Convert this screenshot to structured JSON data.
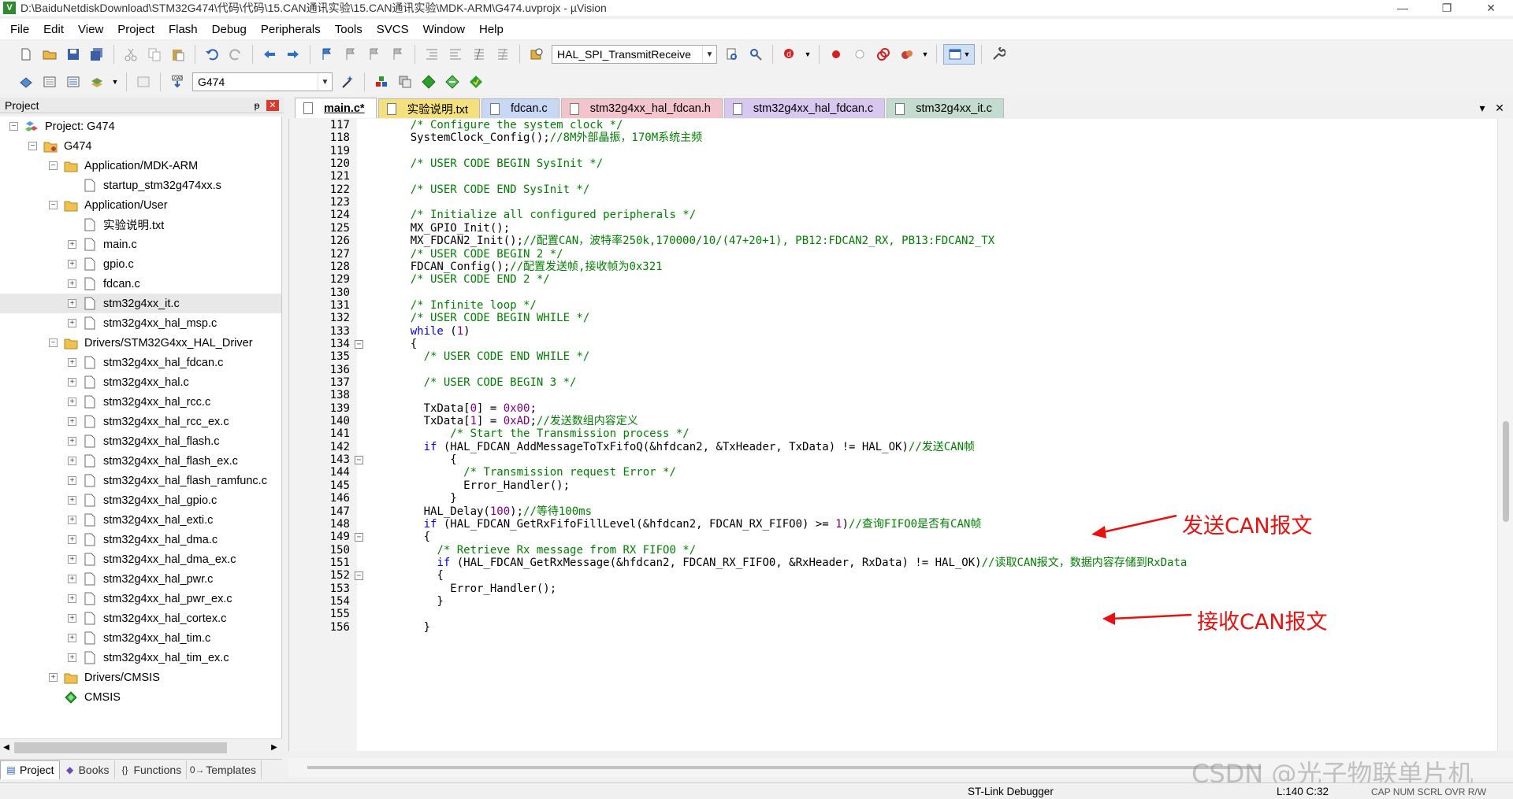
{
  "window": {
    "title": "D:\\BaiduNetdiskDownload\\STM32G474\\代码\\代码\\15.CAN通讯实验\\15.CAN通讯实验\\MDK-ARM\\G474.uvprojx - µVision",
    "minimize": "—",
    "maximize": "❐",
    "close": "✕"
  },
  "menu": [
    "File",
    "Edit",
    "View",
    "Project",
    "Flash",
    "Debug",
    "Peripherals",
    "Tools",
    "SVCS",
    "Window",
    "Help"
  ],
  "toolbar": {
    "find_combo": "HAL_SPI_TransmitReceive",
    "target_combo": "G474"
  },
  "project_panel": {
    "title": "Project",
    "pin": "ᵽ",
    "close": "✕",
    "tree": [
      {
        "label": "Project: G474",
        "level": 0,
        "expander": "−",
        "icon": "project"
      },
      {
        "label": "G474",
        "level": 1,
        "expander": "−",
        "icon": "target-folder"
      },
      {
        "label": "Application/MDK-ARM",
        "level": 2,
        "expander": "−",
        "icon": "folder"
      },
      {
        "label": "startup_stm32g474xx.s",
        "level": 3,
        "expander": "",
        "icon": "file"
      },
      {
        "label": "Application/User",
        "level": 2,
        "expander": "−",
        "icon": "folder"
      },
      {
        "label": "实验说明.txt",
        "level": 3,
        "expander": "",
        "icon": "file"
      },
      {
        "label": "main.c",
        "level": 3,
        "expander": "+",
        "icon": "file"
      },
      {
        "label": "gpio.c",
        "level": 3,
        "expander": "+",
        "icon": "file"
      },
      {
        "label": "fdcan.c",
        "level": 3,
        "expander": "+",
        "icon": "file"
      },
      {
        "label": "stm32g4xx_it.c",
        "level": 3,
        "expander": "+",
        "icon": "file",
        "selected": true
      },
      {
        "label": "stm32g4xx_hal_msp.c",
        "level": 3,
        "expander": "+",
        "icon": "file"
      },
      {
        "label": "Drivers/STM32G4xx_HAL_Driver",
        "level": 2,
        "expander": "−",
        "icon": "folder"
      },
      {
        "label": "stm32g4xx_hal_fdcan.c",
        "level": 3,
        "expander": "+",
        "icon": "file"
      },
      {
        "label": "stm32g4xx_hal.c",
        "level": 3,
        "expander": "+",
        "icon": "file"
      },
      {
        "label": "stm32g4xx_hal_rcc.c",
        "level": 3,
        "expander": "+",
        "icon": "file"
      },
      {
        "label": "stm32g4xx_hal_rcc_ex.c",
        "level": 3,
        "expander": "+",
        "icon": "file"
      },
      {
        "label": "stm32g4xx_hal_flash.c",
        "level": 3,
        "expander": "+",
        "icon": "file"
      },
      {
        "label": "stm32g4xx_hal_flash_ex.c",
        "level": 3,
        "expander": "+",
        "icon": "file"
      },
      {
        "label": "stm32g4xx_hal_flash_ramfunc.c",
        "level": 3,
        "expander": "+",
        "icon": "file"
      },
      {
        "label": "stm32g4xx_hal_gpio.c",
        "level": 3,
        "expander": "+",
        "icon": "file"
      },
      {
        "label": "stm32g4xx_hal_exti.c",
        "level": 3,
        "expander": "+",
        "icon": "file"
      },
      {
        "label": "stm32g4xx_hal_dma.c",
        "level": 3,
        "expander": "+",
        "icon": "file"
      },
      {
        "label": "stm32g4xx_hal_dma_ex.c",
        "level": 3,
        "expander": "+",
        "icon": "file"
      },
      {
        "label": "stm32g4xx_hal_pwr.c",
        "level": 3,
        "expander": "+",
        "icon": "file"
      },
      {
        "label": "stm32g4xx_hal_pwr_ex.c",
        "level": 3,
        "expander": "+",
        "icon": "file"
      },
      {
        "label": "stm32g4xx_hal_cortex.c",
        "level": 3,
        "expander": "+",
        "icon": "file"
      },
      {
        "label": "stm32g4xx_hal_tim.c",
        "level": 3,
        "expander": "+",
        "icon": "file"
      },
      {
        "label": "stm32g4xx_hal_tim_ex.c",
        "level": 3,
        "expander": "+",
        "icon": "file"
      },
      {
        "label": "Drivers/CMSIS",
        "level": 2,
        "expander": "+",
        "icon": "folder"
      },
      {
        "label": "CMSIS",
        "level": 2,
        "expander": "",
        "icon": "cmsis-diamond"
      }
    ],
    "bottom_tabs": [
      {
        "label": "Project",
        "icon": "project-tab-icon",
        "glyph": "▤"
      },
      {
        "label": "Books",
        "icon": "books-icon",
        "glyph": "◆"
      },
      {
        "label": "Functions",
        "icon": "functions-icon",
        "glyph": "{}"
      },
      {
        "label": "Templates",
        "icon": "templates-icon",
        "glyph": "0→"
      }
    ]
  },
  "editor_tabs": [
    {
      "label": "main.c*",
      "color": "#c8d8f4",
      "active": true
    },
    {
      "label": "实验说明.txt",
      "color": "#f4e07c"
    },
    {
      "label": "fdcan.c",
      "color": "#c8d8f4"
    },
    {
      "label": "stm32g4xx_hal_fdcan.h",
      "color": "#f4c4cc"
    },
    {
      "label": "stm32g4xx_hal_fdcan.c",
      "color": "#d8c8f0"
    },
    {
      "label": "stm32g4xx_it.c",
      "color": "#c4dcd0"
    }
  ],
  "tab_controls": {
    "dropdown": "▾",
    "close": "✕"
  },
  "code_lines": [
    {
      "n": "117",
      "fold": "",
      "seg": [
        [
          "    ",
          ""
        ],
        [
          "/* Configure the system clock */",
          "cm"
        ]
      ]
    },
    {
      "n": "118",
      "fold": "",
      "seg": [
        [
          "    SystemClock_Config();",
          ""
        ],
        [
          "//8M外部晶振，170M系统主频",
          "cm"
        ]
      ]
    },
    {
      "n": "119",
      "fold": "",
      "seg": []
    },
    {
      "n": "120",
      "fold": "",
      "seg": [
        [
          "    ",
          ""
        ],
        [
          "/* USER CODE BEGIN SysInit */",
          "cm"
        ]
      ]
    },
    {
      "n": "121",
      "fold": "",
      "seg": []
    },
    {
      "n": "122",
      "fold": "",
      "seg": [
        [
          "    ",
          ""
        ],
        [
          "/* USER CODE END SysInit */",
          "cm"
        ]
      ]
    },
    {
      "n": "123",
      "fold": "",
      "seg": []
    },
    {
      "n": "124",
      "fold": "",
      "seg": [
        [
          "    ",
          ""
        ],
        [
          "/* Initialize all configured peripherals */",
          "cm"
        ]
      ]
    },
    {
      "n": "125",
      "fold": "",
      "seg": [
        [
          "    MX_GPIO_Init();",
          ""
        ]
      ]
    },
    {
      "n": "126",
      "fold": "",
      "seg": [
        [
          "    MX_FDCAN2_Init();",
          ""
        ],
        [
          "//配置CAN，波特率250k,170000/10/(47+20+1), PB12:FDCAN2_RX, PB13:FDCAN2_TX",
          "cm"
        ]
      ]
    },
    {
      "n": "127",
      "fold": "",
      "seg": [
        [
          "    ",
          ""
        ],
        [
          "/* USER CODE BEGIN 2 */",
          "cm"
        ]
      ]
    },
    {
      "n": "128",
      "fold": "",
      "seg": [
        [
          "    FDCAN_Config();",
          ""
        ],
        [
          "//配置发送帧,接收帧为0x321",
          "cm"
        ]
      ]
    },
    {
      "n": "129",
      "fold": "",
      "seg": [
        [
          "    ",
          ""
        ],
        [
          "/* USER CODE END 2 */",
          "cm"
        ]
      ]
    },
    {
      "n": "130",
      "fold": "",
      "seg": []
    },
    {
      "n": "131",
      "fold": "",
      "seg": [
        [
          "    ",
          ""
        ],
        [
          "/* Infinite loop */",
          "cm"
        ]
      ]
    },
    {
      "n": "132",
      "fold": "",
      "seg": [
        [
          "    ",
          ""
        ],
        [
          "/* USER CODE BEGIN WHILE */",
          "cm"
        ]
      ]
    },
    {
      "n": "133",
      "fold": "",
      "seg": [
        [
          "    ",
          ""
        ],
        [
          "while",
          "kw"
        ],
        [
          " (",
          ""
        ],
        [
          "1",
          "num"
        ],
        [
          ")",
          ""
        ]
      ]
    },
    {
      "n": "134",
      "fold": "−",
      "seg": [
        [
          "    {",
          ""
        ]
      ]
    },
    {
      "n": "135",
      "fold": "",
      "seg": [
        [
          "      ",
          ""
        ],
        [
          "/* USER CODE END WHILE */",
          "cm"
        ]
      ]
    },
    {
      "n": "136",
      "fold": "",
      "seg": []
    },
    {
      "n": "137",
      "fold": "",
      "seg": [
        [
          "      ",
          ""
        ],
        [
          "/* USER CODE BEGIN 3 */",
          "cm"
        ]
      ]
    },
    {
      "n": "138",
      "fold": "",
      "seg": []
    },
    {
      "n": "139",
      "fold": "",
      "seg": [
        [
          "      TxData[",
          ""
        ],
        [
          "0",
          "num"
        ],
        [
          "] = ",
          ""
        ],
        [
          "0x00",
          "num"
        ],
        [
          ";",
          ""
        ]
      ]
    },
    {
      "n": "140",
      "fold": "",
      "seg": [
        [
          "      TxData[",
          ""
        ],
        [
          "1",
          "num"
        ],
        [
          "] = ",
          ""
        ],
        [
          "0xAD",
          "num"
        ],
        [
          ";",
          ""
        ],
        [
          "//发送数组内容定义",
          "cm"
        ]
      ]
    },
    {
      "n": "141",
      "fold": "",
      "seg": [
        [
          "          ",
          ""
        ],
        [
          "/* Start the Transmission process */",
          "cm"
        ]
      ]
    },
    {
      "n": "142",
      "fold": "",
      "seg": [
        [
          "      ",
          ""
        ],
        [
          "if",
          "kw"
        ],
        [
          " (HAL_FDCAN_AddMessageToTxFifoQ(&hfdcan2, &TxHeader, TxData) != HAL_OK)",
          ""
        ],
        [
          "//发送CAN帧",
          "cm"
        ]
      ]
    },
    {
      "n": "143",
      "fold": "−",
      "seg": [
        [
          "          {",
          ""
        ]
      ]
    },
    {
      "n": "144",
      "fold": "",
      "seg": [
        [
          "            ",
          ""
        ],
        [
          "/* Transmission request Error */",
          "cm"
        ]
      ]
    },
    {
      "n": "145",
      "fold": "",
      "seg": [
        [
          "            Error_Handler();",
          ""
        ]
      ]
    },
    {
      "n": "146",
      "fold": "",
      "seg": [
        [
          "          }",
          ""
        ]
      ]
    },
    {
      "n": "147",
      "fold": "",
      "seg": [
        [
          "      HAL_Delay(",
          ""
        ],
        [
          "100",
          "num"
        ],
        [
          ");",
          ""
        ],
        [
          "//等待100ms",
          "cm"
        ]
      ]
    },
    {
      "n": "148",
      "fold": "",
      "seg": [
        [
          "      ",
          ""
        ],
        [
          "if",
          "kw"
        ],
        [
          " (HAL_FDCAN_GetRxFifoFillLevel(&hfdcan2, FDCAN_RX_FIFO0) >= ",
          ""
        ],
        [
          "1",
          "num"
        ],
        [
          ")",
          ""
        ],
        [
          "//查询FIFO0是否有CAN帧",
          "cm"
        ]
      ]
    },
    {
      "n": "149",
      "fold": "−",
      "seg": [
        [
          "      {",
          ""
        ]
      ]
    },
    {
      "n": "150",
      "fold": "",
      "seg": [
        [
          "        ",
          ""
        ],
        [
          "/* Retrieve Rx message from RX FIFO0 */",
          "cm"
        ]
      ]
    },
    {
      "n": "151",
      "fold": "",
      "seg": [
        [
          "        ",
          ""
        ],
        [
          "if",
          "kw"
        ],
        [
          " (HAL_FDCAN_GetRxMessage(&hfdcan2, FDCAN_RX_FIFO0, &RxHeader, RxData) != HAL_OK)",
          ""
        ],
        [
          "//读取CAN报文，数据内容存储到RxData",
          "cm"
        ]
      ]
    },
    {
      "n": "152",
      "fold": "−",
      "seg": [
        [
          "        {",
          ""
        ]
      ]
    },
    {
      "n": "153",
      "fold": "",
      "seg": [
        [
          "          Error_Handler();",
          ""
        ]
      ]
    },
    {
      "n": "154",
      "fold": "",
      "seg": [
        [
          "        }",
          ""
        ]
      ]
    },
    {
      "n": "155",
      "fold": "",
      "seg": []
    },
    {
      "n": "156",
      "fold": "",
      "seg": [
        [
          "      }",
          ""
        ]
      ]
    }
  ],
  "annotations": {
    "send": "发送CAN报文",
    "receive": "接收CAN报文",
    "color": "#e8110f"
  },
  "status": {
    "debugger": "ST-Link Debugger",
    "position": "L:140 C:32",
    "indicators": "CAP  NUM  SCRL  OVR  R/W"
  },
  "watermark": "CSDN @光子物联单片机",
  "colors": {
    "comment": "#008000",
    "keyword": "#0000e0",
    "number": "#800080"
  }
}
